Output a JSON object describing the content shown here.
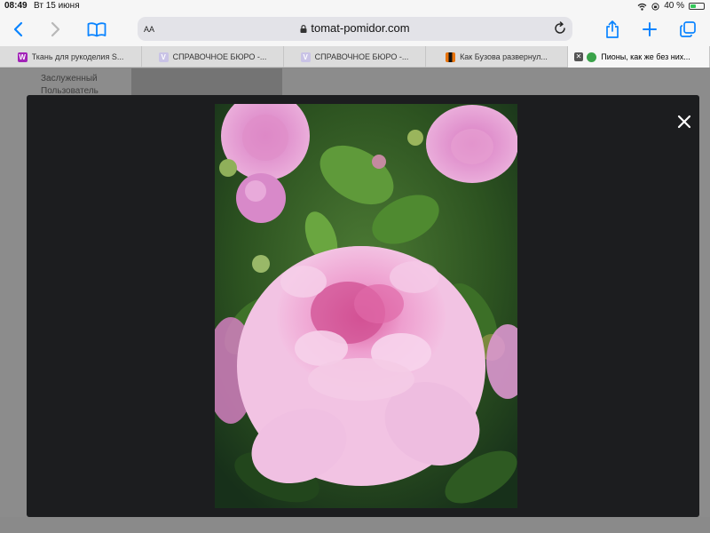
{
  "status_bar": {
    "time": "08:49",
    "date": "Вт 15 июня",
    "battery_text": "40 %",
    "battery_level_percent": 40
  },
  "toolbar": {
    "text_size_label": "AA",
    "url": "tomat-pomidor.com"
  },
  "tabs": [
    {
      "title": "Ткань для рукоделия S...",
      "favicon_letter": "W",
      "favicon_color": "#a223b8",
      "active": false
    },
    {
      "title": "СПРАВОЧНОЕ БЮРО -...",
      "favicon_letter": "V",
      "favicon_color": "#c9c3e6",
      "active": false
    },
    {
      "title": "СПРАВОЧНОЕ БЮРО -...",
      "favicon_letter": "V",
      "favicon_color": "#c9c3e6",
      "active": false
    },
    {
      "title": "Как Бузова развернул...",
      "favicon_letter": "",
      "favicon_color": "#e8730c",
      "active": false
    },
    {
      "title": "Пионы, как же без них...",
      "favicon_letter": "",
      "favicon_color": "#3aa34a",
      "active": true
    }
  ],
  "page": {
    "user_line1": "Заслуженный",
    "user_line2": "Пользователь"
  },
  "colors": {
    "accent": "#0a84ff",
    "overlay": "#1c1d1f",
    "peony_pink": "#e6a8d8",
    "foliage": "#2f5a25"
  }
}
